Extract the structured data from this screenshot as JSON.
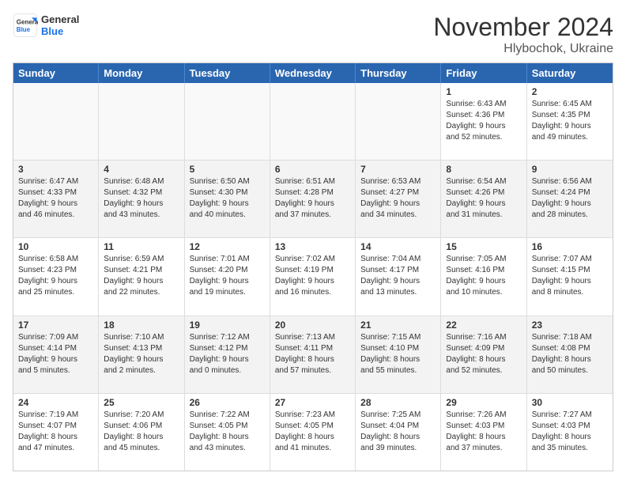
{
  "logo": {
    "line1": "General",
    "line2": "Blue"
  },
  "header": {
    "month": "November 2024",
    "location": "Hlybochok, Ukraine"
  },
  "days": [
    "Sunday",
    "Monday",
    "Tuesday",
    "Wednesday",
    "Thursday",
    "Friday",
    "Saturday"
  ],
  "rows": [
    [
      {
        "day": "",
        "info": ""
      },
      {
        "day": "",
        "info": ""
      },
      {
        "day": "",
        "info": ""
      },
      {
        "day": "",
        "info": ""
      },
      {
        "day": "",
        "info": ""
      },
      {
        "day": "1",
        "info": "Sunrise: 6:43 AM\nSunset: 4:36 PM\nDaylight: 9 hours\nand 52 minutes."
      },
      {
        "day": "2",
        "info": "Sunrise: 6:45 AM\nSunset: 4:35 PM\nDaylight: 9 hours\nand 49 minutes."
      }
    ],
    [
      {
        "day": "3",
        "info": "Sunrise: 6:47 AM\nSunset: 4:33 PM\nDaylight: 9 hours\nand 46 minutes."
      },
      {
        "day": "4",
        "info": "Sunrise: 6:48 AM\nSunset: 4:32 PM\nDaylight: 9 hours\nand 43 minutes."
      },
      {
        "day": "5",
        "info": "Sunrise: 6:50 AM\nSunset: 4:30 PM\nDaylight: 9 hours\nand 40 minutes."
      },
      {
        "day": "6",
        "info": "Sunrise: 6:51 AM\nSunset: 4:28 PM\nDaylight: 9 hours\nand 37 minutes."
      },
      {
        "day": "7",
        "info": "Sunrise: 6:53 AM\nSunset: 4:27 PM\nDaylight: 9 hours\nand 34 minutes."
      },
      {
        "day": "8",
        "info": "Sunrise: 6:54 AM\nSunset: 4:26 PM\nDaylight: 9 hours\nand 31 minutes."
      },
      {
        "day": "9",
        "info": "Sunrise: 6:56 AM\nSunset: 4:24 PM\nDaylight: 9 hours\nand 28 minutes."
      }
    ],
    [
      {
        "day": "10",
        "info": "Sunrise: 6:58 AM\nSunset: 4:23 PM\nDaylight: 9 hours\nand 25 minutes."
      },
      {
        "day": "11",
        "info": "Sunrise: 6:59 AM\nSunset: 4:21 PM\nDaylight: 9 hours\nand 22 minutes."
      },
      {
        "day": "12",
        "info": "Sunrise: 7:01 AM\nSunset: 4:20 PM\nDaylight: 9 hours\nand 19 minutes."
      },
      {
        "day": "13",
        "info": "Sunrise: 7:02 AM\nSunset: 4:19 PM\nDaylight: 9 hours\nand 16 minutes."
      },
      {
        "day": "14",
        "info": "Sunrise: 7:04 AM\nSunset: 4:17 PM\nDaylight: 9 hours\nand 13 minutes."
      },
      {
        "day": "15",
        "info": "Sunrise: 7:05 AM\nSunset: 4:16 PM\nDaylight: 9 hours\nand 10 minutes."
      },
      {
        "day": "16",
        "info": "Sunrise: 7:07 AM\nSunset: 4:15 PM\nDaylight: 9 hours\nand 8 minutes."
      }
    ],
    [
      {
        "day": "17",
        "info": "Sunrise: 7:09 AM\nSunset: 4:14 PM\nDaylight: 9 hours\nand 5 minutes."
      },
      {
        "day": "18",
        "info": "Sunrise: 7:10 AM\nSunset: 4:13 PM\nDaylight: 9 hours\nand 2 minutes."
      },
      {
        "day": "19",
        "info": "Sunrise: 7:12 AM\nSunset: 4:12 PM\nDaylight: 9 hours\nand 0 minutes."
      },
      {
        "day": "20",
        "info": "Sunrise: 7:13 AM\nSunset: 4:11 PM\nDaylight: 8 hours\nand 57 minutes."
      },
      {
        "day": "21",
        "info": "Sunrise: 7:15 AM\nSunset: 4:10 PM\nDaylight: 8 hours\nand 55 minutes."
      },
      {
        "day": "22",
        "info": "Sunrise: 7:16 AM\nSunset: 4:09 PM\nDaylight: 8 hours\nand 52 minutes."
      },
      {
        "day": "23",
        "info": "Sunrise: 7:18 AM\nSunset: 4:08 PM\nDaylight: 8 hours\nand 50 minutes."
      }
    ],
    [
      {
        "day": "24",
        "info": "Sunrise: 7:19 AM\nSunset: 4:07 PM\nDaylight: 8 hours\nand 47 minutes."
      },
      {
        "day": "25",
        "info": "Sunrise: 7:20 AM\nSunset: 4:06 PM\nDaylight: 8 hours\nand 45 minutes."
      },
      {
        "day": "26",
        "info": "Sunrise: 7:22 AM\nSunset: 4:05 PM\nDaylight: 8 hours\nand 43 minutes."
      },
      {
        "day": "27",
        "info": "Sunrise: 7:23 AM\nSunset: 4:05 PM\nDaylight: 8 hours\nand 41 minutes."
      },
      {
        "day": "28",
        "info": "Sunrise: 7:25 AM\nSunset: 4:04 PM\nDaylight: 8 hours\nand 39 minutes."
      },
      {
        "day": "29",
        "info": "Sunrise: 7:26 AM\nSunset: 4:03 PM\nDaylight: 8 hours\nand 37 minutes."
      },
      {
        "day": "30",
        "info": "Sunrise: 7:27 AM\nSunset: 4:03 PM\nDaylight: 8 hours\nand 35 minutes."
      }
    ]
  ]
}
